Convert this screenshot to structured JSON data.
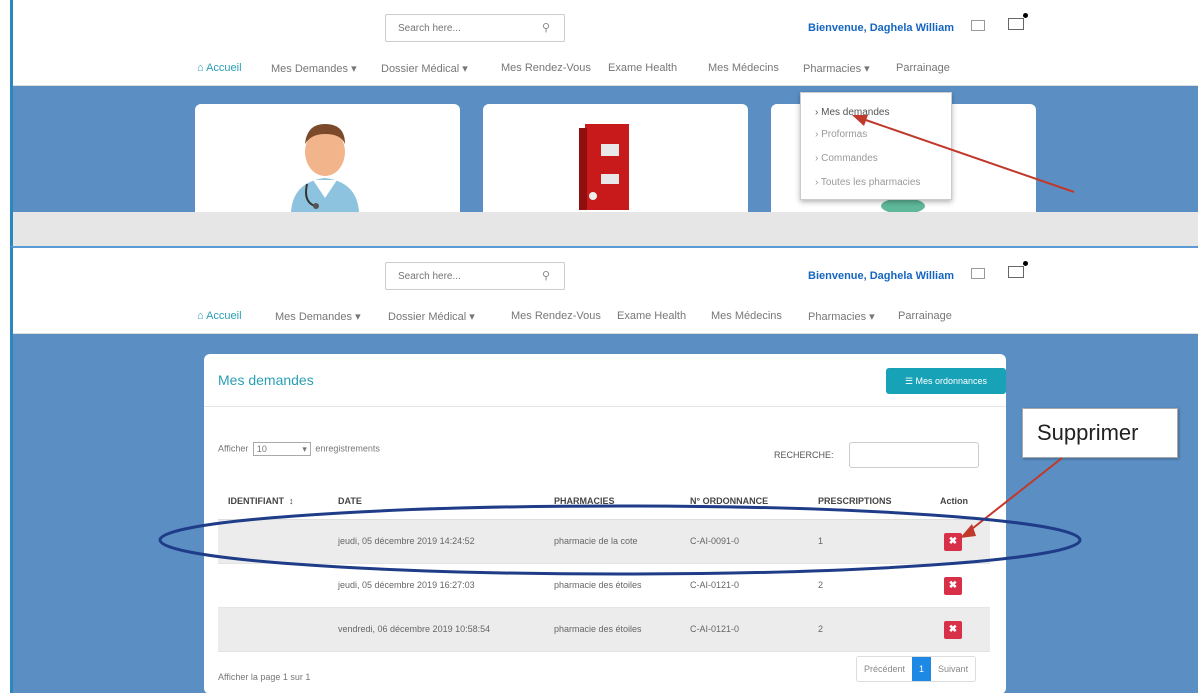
{
  "header": {
    "search_placeholder": "Search here...",
    "welcome_text": "Bienvenue, Daghela William"
  },
  "nav": {
    "items": [
      "Accueil",
      "Mes Demandes ▾",
      "Dossier Médical ▾",
      "Mes Rendez-Vous",
      "Exame Health",
      "Mes Médecins",
      "Pharmacies ▾",
      "Parrainage"
    ],
    "active": "Accueil"
  },
  "pharmacies_dropdown": {
    "items": [
      "› Mes demandes",
      "› Proformas",
      "› Commandes",
      "› Toutes les pharmacies"
    ]
  },
  "panel": {
    "title": "Mes demandes",
    "ordonnances_button": "Mes ordonnances",
    "show_label_prefix": "Afficher",
    "show_value": "10",
    "show_label_suffix": "enregistrements",
    "search_label": "RECHERCHE:",
    "columns": [
      "IDENTIFIANT",
      "DATE",
      "PHARMACIES",
      "N° ORDONNANCE",
      "PRESCRIPTIONS",
      "Action"
    ],
    "rows": [
      {
        "identifiant": "",
        "date": "jeudi, 05 décembre 2019 14:24:52",
        "pharmacie": "pharmacie de la cote",
        "ordonnance": "C-AI-0091-0",
        "prescriptions": "1",
        "action": "✖"
      },
      {
        "identifiant": "",
        "date": "jeudi, 05 décembre 2019 16:27:03",
        "pharmacie": "pharmacie des étoiles",
        "ordonnance": "C-AI-0121-0",
        "prescriptions": "2",
        "action": "✖"
      },
      {
        "identifiant": "",
        "date": "vendredi, 06 décembre 2019 10:58:54",
        "pharmacie": "pharmacie des étoiles",
        "ordonnance": "C-AI-0121-0",
        "prescriptions": "2",
        "action": "✖"
      }
    ],
    "page_info": "Afficher la page 1 sur 1",
    "pagination": {
      "prev": "Précédent",
      "current": "1",
      "next": "Suivant"
    }
  },
  "annotation": {
    "callout_text": "Supprimer"
  },
  "colors": {
    "accent": "#2a9fb5",
    "banner": "#5b8fc4",
    "delete": "#d9304a",
    "arrow": "#c0392b",
    "ellipse": "#1f3c88"
  }
}
